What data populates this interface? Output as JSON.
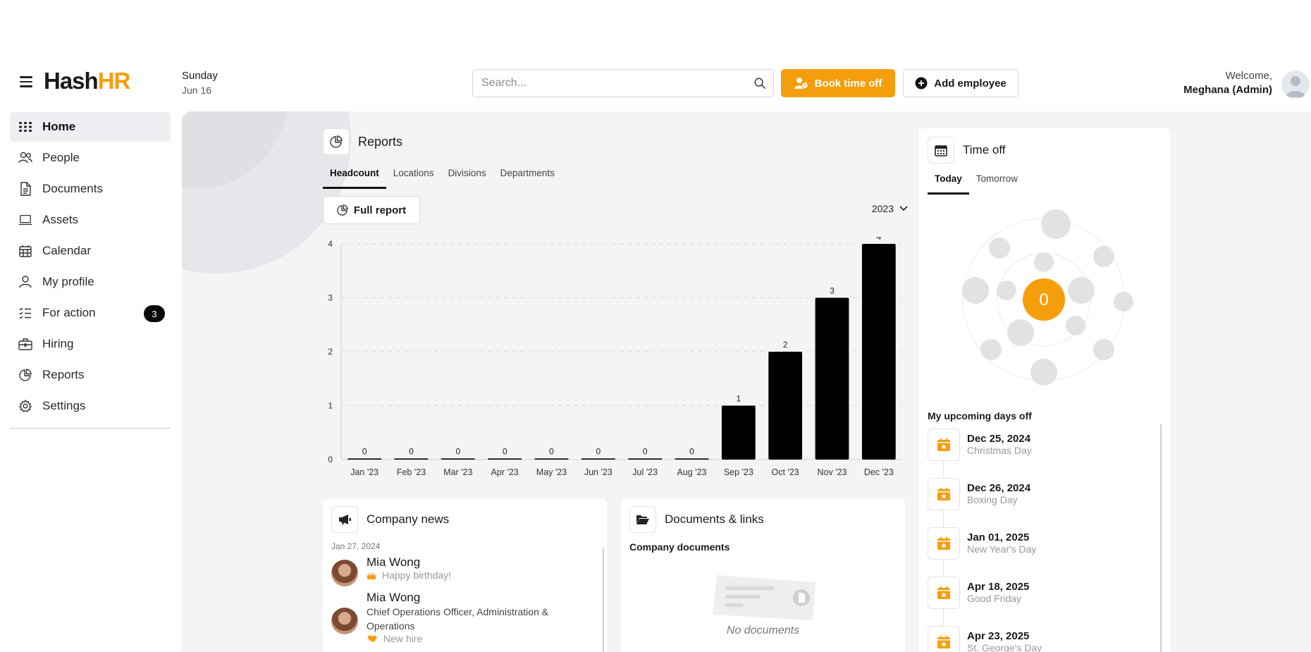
{
  "brand": {
    "name_part1": "Hash",
    "name_part2": "HR",
    "accent": "#f59e0b"
  },
  "date": {
    "day": "Sunday",
    "month_day": "Jun 16"
  },
  "search": {
    "placeholder": "Search..."
  },
  "actions": {
    "book_time_off": "Book time off",
    "add_employee": "Add employee"
  },
  "user": {
    "welcome": "Welcome,",
    "name": "Meghana (Admin)"
  },
  "sidebar": {
    "items": [
      {
        "label": "Home",
        "icon": "grid-icon"
      },
      {
        "label": "People",
        "icon": "people-icon"
      },
      {
        "label": "Documents",
        "icon": "document-icon"
      },
      {
        "label": "Assets",
        "icon": "laptop-icon"
      },
      {
        "label": "Calendar",
        "icon": "calendar-icon"
      },
      {
        "label": "My profile",
        "icon": "user-icon"
      },
      {
        "label": "For action",
        "icon": "checklist-icon",
        "badge": "3"
      },
      {
        "label": "Hiring",
        "icon": "briefcase-icon"
      },
      {
        "label": "Reports",
        "icon": "pie-chart-icon"
      },
      {
        "label": "Settings",
        "icon": "gear-icon"
      }
    ]
  },
  "reports": {
    "title": "Reports",
    "tabs": [
      "Headcount",
      "Locations",
      "Divisions",
      "Departments"
    ],
    "full_report": "Full report",
    "year": "2023"
  },
  "chart_data": {
    "type": "bar",
    "categories": [
      "Jan '23",
      "Feb '23",
      "Mar '23",
      "Apr '23",
      "May '23",
      "Jun '23",
      "Jul '23",
      "Aug '23",
      "Sep '23",
      "Oct '23",
      "Nov '23",
      "Dec '23"
    ],
    "values": [
      0,
      0,
      0,
      0,
      0,
      0,
      0,
      0,
      1,
      2,
      3,
      4
    ],
    "yticks": [
      "0",
      "1",
      "2",
      "3",
      "4"
    ],
    "ylim": [
      0,
      4
    ],
    "grid": true,
    "bar_color": "#000000"
  },
  "news": {
    "title": "Company news",
    "date": "Jan 27, 2024",
    "items": [
      {
        "name": "Mia Wong",
        "sub": "Happy birthday!"
      },
      {
        "name": "Mia Wong",
        "role": "Chief Operations Officer, Administration & Operations",
        "sub": "New hire"
      }
    ]
  },
  "docs": {
    "title": "Documents & links",
    "subtitle": "Company documents",
    "empty": "No documents"
  },
  "timeoff": {
    "title": "Time off",
    "tabs": [
      "Today",
      "Tomorrow"
    ],
    "count": "0",
    "upcoming_title": "My upcoming days off",
    "items": [
      {
        "date": "Dec 25, 2024",
        "holiday": "Christmas Day"
      },
      {
        "date": "Dec 26, 2024",
        "holiday": "Boxing Day"
      },
      {
        "date": "Jan 01, 2025",
        "holiday": "New Year's Day"
      },
      {
        "date": "Apr 18, 2025",
        "holiday": "Good Friday"
      },
      {
        "date": "Apr 23, 2025",
        "holiday": "St. George's Day"
      }
    ]
  }
}
